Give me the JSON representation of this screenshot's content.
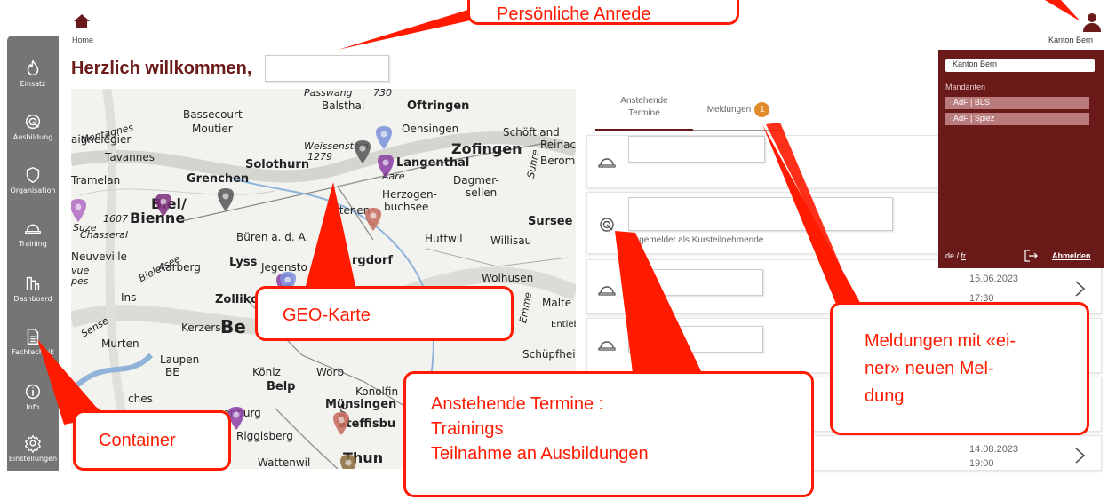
{
  "header": {
    "home_label": "Home",
    "welcome": "Herzlich willkommen,",
    "name_value": ""
  },
  "sidebar": {
    "items": [
      {
        "label": "Einsatz",
        "icon": "flame-icon"
      },
      {
        "label": "Ausbildung",
        "icon": "target-icon"
      },
      {
        "label": "Organisation",
        "icon": "shield-icon"
      },
      {
        "label": "Training",
        "icon": "helmet-icon"
      },
      {
        "label": "Dashboard",
        "icon": "chart-icon"
      },
      {
        "label": "Fachtechnik",
        "icon": "document-icon"
      },
      {
        "label": "Info",
        "icon": "info-icon"
      },
      {
        "label": "Einstellungen",
        "icon": "gear-icon"
      }
    ]
  },
  "map": {
    "labels": [
      "Passwang",
      "730",
      "Balsthal",
      "Oftringen",
      "Bassecourt",
      "Moutier",
      "Oensingen",
      "Schöftland",
      "aignelégier",
      "Weissenstein",
      "1279",
      "Zofingen",
      "Reinac",
      "Tavannes",
      "Montagnes",
      "Solothurn",
      "Langenthal",
      "Berom",
      "Tramelan",
      "Grenchen",
      "Aare",
      "Dagmer-",
      "sellen",
      "Herzogen-",
      "buchsee",
      "Sursee",
      "Biel/",
      "Bienne",
      "1607",
      "Suze",
      "Chasseral",
      "Büren a. d. A.",
      "Huttwil",
      "Willisau",
      "Neuveville",
      "Aarberg",
      "Lyss",
      "Jegensto",
      "rgdorf",
      "Wolhusen",
      "vue",
      "pes",
      "Ins",
      "Zolliko",
      "Be",
      "Kerzers",
      "Malte",
      "Entlebu",
      "Murten",
      "Laupen",
      "BE",
      "Schüpfhei",
      "Köniz",
      "Worb",
      "Belp",
      "Konolfin",
      "ches",
      "rzenburg",
      "Münsingen",
      "Riggisberg",
      "Steffisbu",
      "Thun",
      "Wattenwil",
      "Emme",
      "Sense",
      "Aare",
      "Bielersee",
      "Urtenen",
      "Suhre"
    ],
    "pin_colors": [
      "#7b8fd8",
      "#555555",
      "#8a3ca3",
      "#555555",
      "#c7685a",
      "#b06bc4",
      "#7b2d7b",
      "#8a3ca3",
      "#8a3ca3",
      "#c7685a",
      "#8b6a3a",
      "#7b8fd8"
    ]
  },
  "tabs": [
    {
      "label": "Anstehende Termine"
    },
    {
      "label": "Meldungen",
      "badge": "1"
    }
  ],
  "list": {
    "rows": [
      {
        "type": "training",
        "value": "",
        "sub": "",
        "date": "",
        "time": ""
      },
      {
        "type": "course",
        "value": "",
        "sub": "Angemeldet als Kursteilnehmende",
        "date": "",
        "time": ""
      },
      {
        "type": "training",
        "value": "",
        "sub": "",
        "date": "15.06.2023",
        "time": "17:30"
      },
      {
        "type": "training",
        "value": "",
        "sub": "",
        "date": "",
        "time": ""
      },
      {
        "type": "training",
        "value": "",
        "sub": "",
        "date": "",
        "time": ""
      },
      {
        "type": "training",
        "value": "",
        "sub": "",
        "date": "14.08.2023",
        "time": "19:00"
      }
    ]
  },
  "user": {
    "name": "Kanton Bern",
    "panel_selected": "Kanton Bern",
    "mandanten_heading": "Mandanten",
    "mandanten": [
      "AdF | BLS",
      "AdF | Spiez"
    ],
    "lang_de": "de",
    "lang_sep": " / ",
    "lang_fr": "fr",
    "logout": "Abmelden"
  },
  "annotations": {
    "anrede": "Persönliche Anrede",
    "geokarte": "GEO-Karte",
    "container": "Container",
    "termine_line1": "Anstehende Termine :",
    "termine_line2": "Trainings",
    "termine_line3": "Teilnahme an Ausbildungen",
    "meldungen_line1": "Meldungen mit «ei-",
    "meldungen_line2": "ner» neuen Mel-",
    "meldungen_line3": "dung",
    "color": "#ff1a00"
  }
}
